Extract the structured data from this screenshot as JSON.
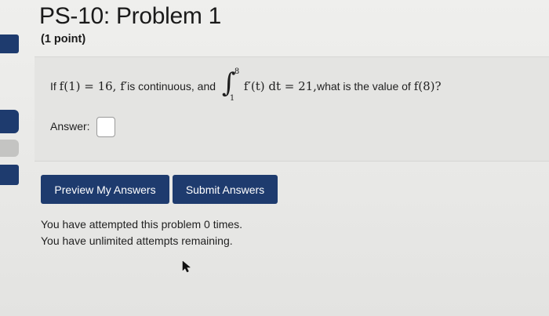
{
  "problem": {
    "title": "PS-10: Problem 1",
    "points": "(1 point)",
    "question": {
      "prefix": "If ",
      "cond1": "f(1) = 16, f′",
      "mid": " is continuous, and ",
      "upper": "8",
      "lower": "1",
      "integrand": "f′(t) dt = 21,",
      "suffix": " what is the value of ",
      "target": "f(8)?"
    },
    "answer_label": "Answer:",
    "answer_value": ""
  },
  "buttons": {
    "preview": "Preview My Answers",
    "submit": "Submit Answers"
  },
  "status": {
    "attempts_line": "You have attempted this problem 0 times.",
    "remaining_line": "You have unlimited attempts remaining."
  },
  "colors": {
    "accent": "#1e3b6e",
    "background": "#e9e9e7"
  }
}
